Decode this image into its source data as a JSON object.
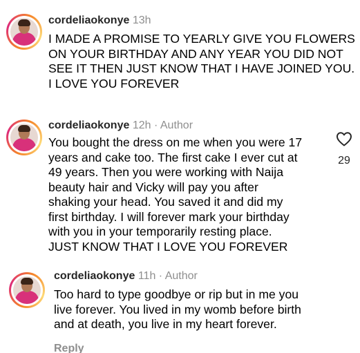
{
  "comments": [
    {
      "username": "cordeliaokonye",
      "time": "13h",
      "author_tag": "",
      "lines": [
        "I MADE A PROMISE TO YEARLY GIVE YOU FLOWERS",
        "ON YOUR BIRTHDAY AND ANY YEAR YOU DID NOT",
        "SEE IT THEN JUST KNOW THAT I HAVE JOINED YOU.",
        "I LOVE YOU FOREVER"
      ]
    },
    {
      "username": "cordeliaokonye",
      "time": "12h",
      "separator": "·",
      "author_tag": "Author",
      "likes": "29",
      "lines": [
        "You bought the dress on me when you were 17",
        "years and cake too. The first cake I ever cut at",
        "49 years. Then you were working with Naija",
        "beauty hair and Vicky will pay you after",
        "shaking your head. You saved it and did my",
        "first birthday. I will forever mark your birthday",
        "with you in your temporarily resting place.",
        "JUST KNOW THAT I LOVE YOU FOREVER"
      ]
    },
    {
      "username": "cordeliaokonye",
      "time": "11h",
      "separator": "·",
      "author_tag": "Author",
      "reply_label": "Reply",
      "lines": [
        "Too hard to type goodbye or rip but in me you",
        "live forever. You lived in my womb before birth",
        "and at death, you live in my heart forever."
      ]
    }
  ],
  "icons": {
    "like": "heart-outline-icon"
  },
  "colors": {
    "username": "#262626",
    "muted": "#8e8e8e",
    "avatar_ring_start": "#f58529",
    "avatar_ring_end": "#dd2a7b"
  }
}
